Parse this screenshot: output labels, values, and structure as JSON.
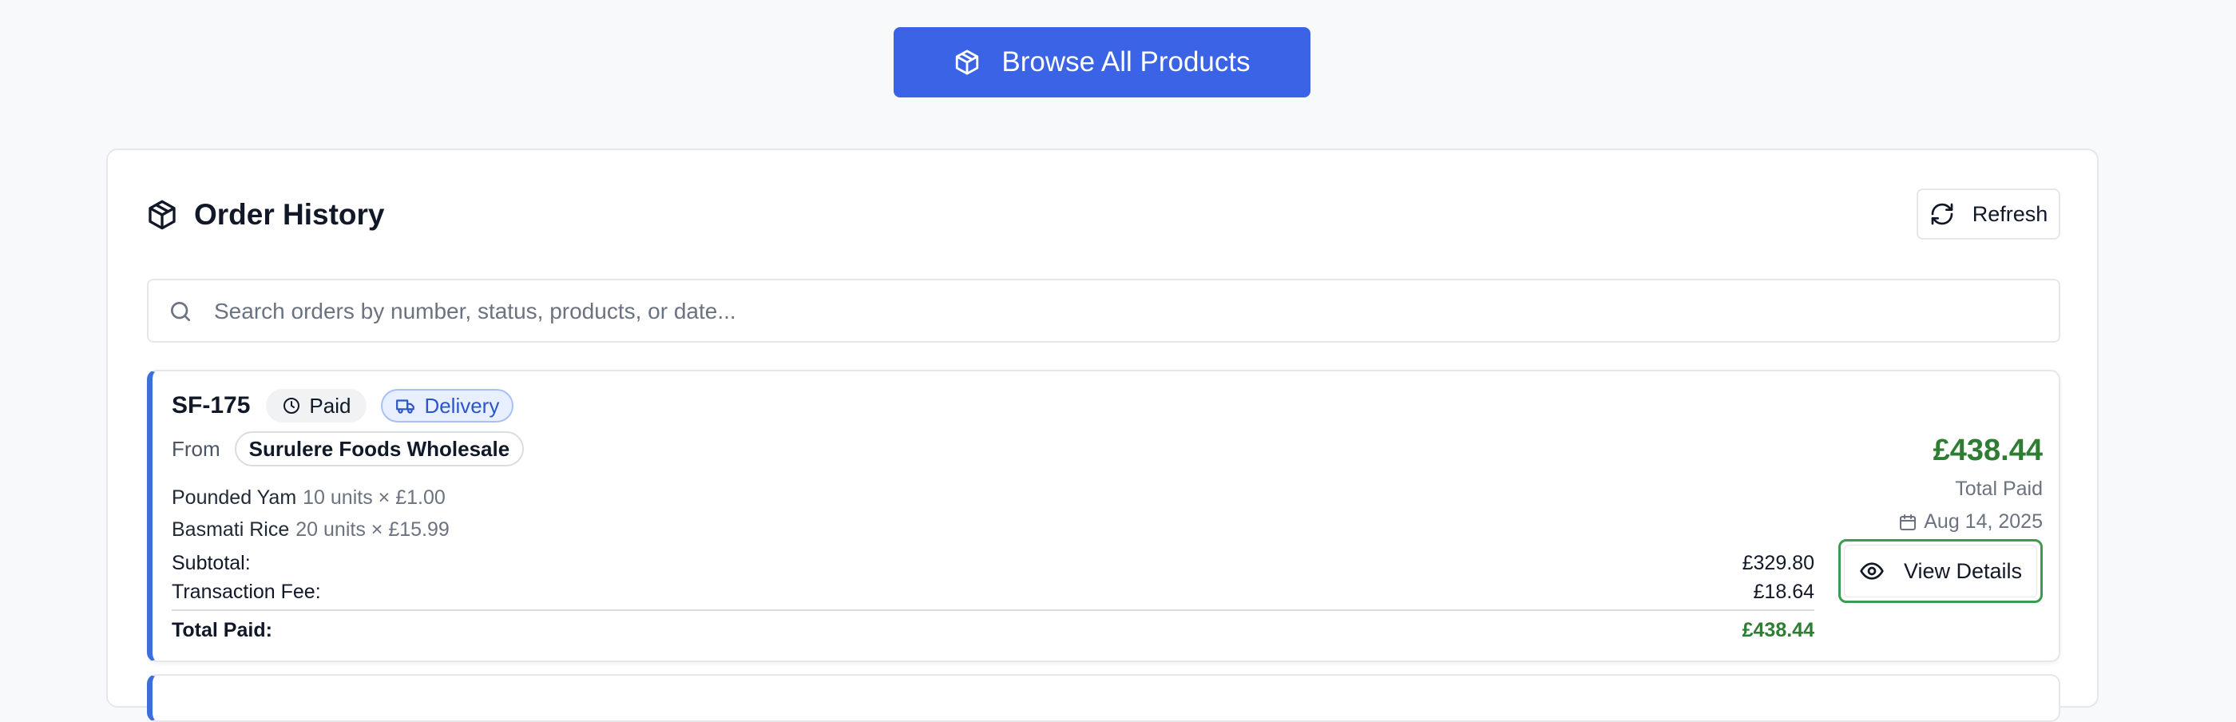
{
  "browse_button": {
    "label": "Browse All Products",
    "icon": "package-icon"
  },
  "order_history": {
    "title": "Order History",
    "refresh_label": "Refresh",
    "search": {
      "placeholder": "Search orders by number, status, products, or date...",
      "value": ""
    }
  },
  "orders": [
    {
      "number": "SF-175",
      "status": "Paid",
      "fulfillment": "Delivery",
      "from_label": "From",
      "vendor": "Surulere Foods Wholesale",
      "items": [
        {
          "name": "Pounded Yam",
          "qty": "10 units × £1.00"
        },
        {
          "name": "Basmati Rice",
          "qty": "20 units × £15.99"
        }
      ],
      "subtotal_label": "Subtotal:",
      "subtotal": "£329.80",
      "fee_label": "Transaction Fee:",
      "fee": "£18.64",
      "total_label": "Total Paid:",
      "total": "£438.44",
      "total_big": "£438.44",
      "total_caption": "Total Paid",
      "date": "Aug 14, 2025",
      "view_label": "View Details"
    }
  ],
  "colors": {
    "primary": "#3b63e6",
    "accent_border": "#3b6fe0",
    "money": "#2e7d32",
    "focus": "#3d9a50"
  }
}
